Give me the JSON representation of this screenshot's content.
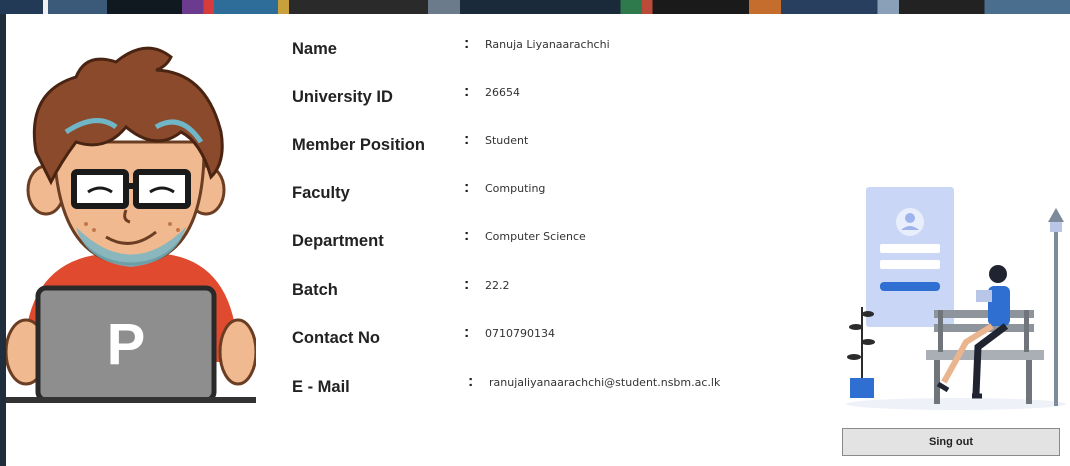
{
  "profile": {
    "fields": [
      {
        "label": "Name",
        "colon": ":",
        "value": "Ranuja Liyanaarachchi"
      },
      {
        "label": "University ID",
        "colon": ":",
        "value": "26654"
      },
      {
        "label": "Member Position",
        "colon": ":",
        "value": "Student"
      },
      {
        "label": "Faculty",
        "colon": ":",
        "value": "Computing"
      },
      {
        "label": "Department",
        "colon": ":",
        "value": "Computer Science"
      },
      {
        "label": "Batch",
        "colon": ":",
        "value": "22.2"
      },
      {
        "label": "Contact No",
        "colon": ":",
        "value": "0710790134"
      },
      {
        "label": "E - Mail",
        "colon": ":",
        "value": "ranujaliyanaarachchi@student.nsbm.ac.lk"
      }
    ]
  },
  "avatar": {
    "laptop_letter": "P",
    "icon": "boy-with-laptop-icon"
  },
  "illustration": {
    "icon": "login-illustration-icon"
  },
  "actions": {
    "signout_label": "Sing out"
  },
  "colors": {
    "accent_blue": "#2f6fd1",
    "shirt_red": "#e04b2f",
    "laptop_gray": "#8e8e8e",
    "button_gray": "#e3e3e3"
  }
}
